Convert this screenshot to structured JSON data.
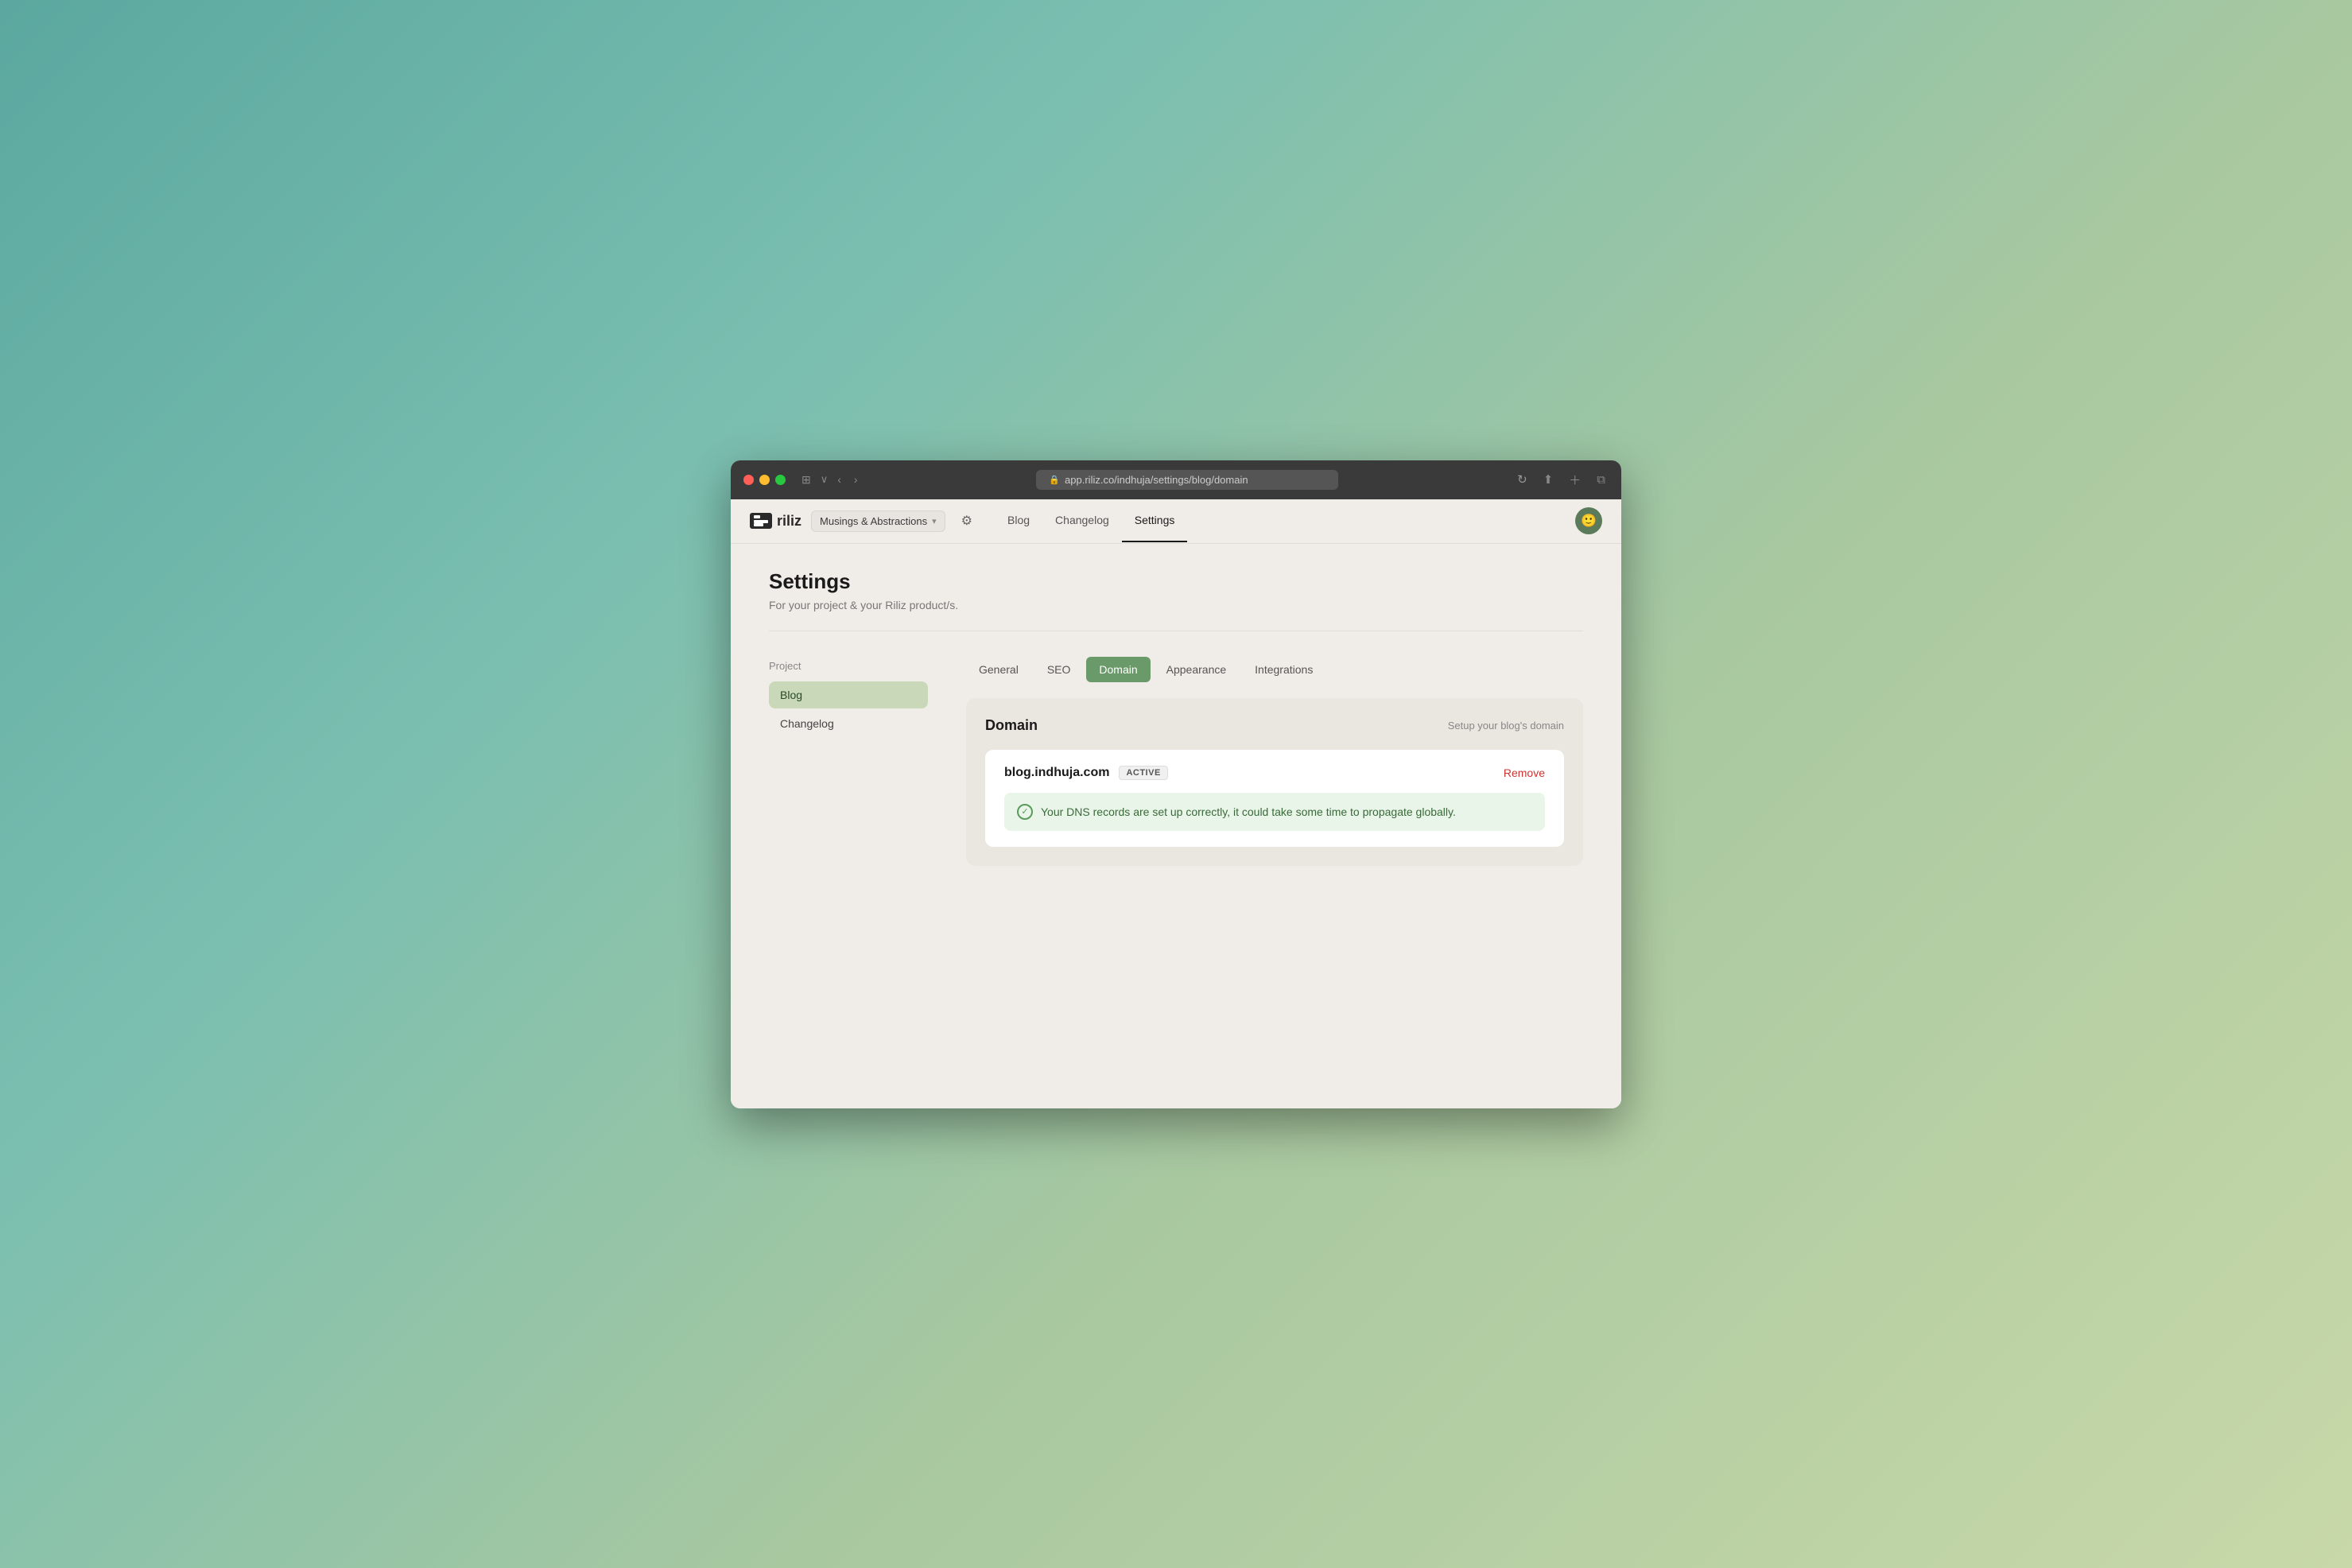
{
  "browser": {
    "address": "app.riliz.co/indhuja/settings/blog/domain",
    "traffic_lights": [
      "red",
      "yellow",
      "green"
    ]
  },
  "app": {
    "logo_text": "riliz",
    "workspace": {
      "name": "Musings & Abstractions",
      "chevron": "▾"
    }
  },
  "nav": {
    "links": [
      {
        "label": "Blog",
        "active": false
      },
      {
        "label": "Changelog",
        "active": false
      },
      {
        "label": "Settings",
        "active": true
      }
    ]
  },
  "page": {
    "title": "Settings",
    "subtitle": "For your project & your Riliz product/s."
  },
  "sidebar": {
    "section_label": "Project",
    "items": [
      {
        "label": "Blog",
        "active": true
      },
      {
        "label": "Changelog",
        "active": false
      }
    ]
  },
  "tabs": [
    {
      "label": "General",
      "active": false
    },
    {
      "label": "SEO",
      "active": false
    },
    {
      "label": "Domain",
      "active": true
    },
    {
      "label": "Appearance",
      "active": false
    },
    {
      "label": "Integrations",
      "active": false
    }
  ],
  "domain_section": {
    "title": "Domain",
    "subtitle": "Setup your blog's domain",
    "entry": {
      "domain_name": "blog.indhuja.com",
      "status": "ACTIVE",
      "remove_label": "Remove",
      "dns_message": "Your DNS records are set up correctly, it could take some time to propagate globally."
    }
  }
}
